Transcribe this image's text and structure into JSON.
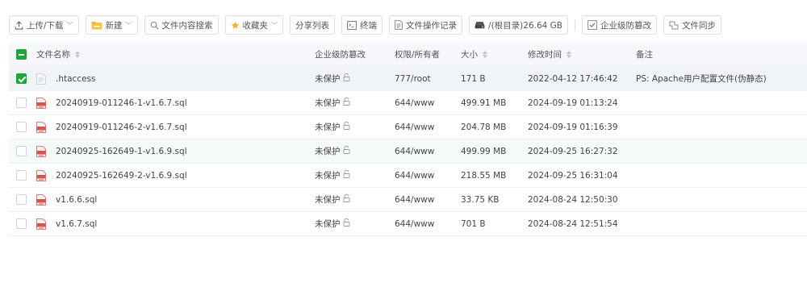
{
  "toolbar": {
    "upload_label": "上传/下载",
    "new_label": "新建",
    "search_label": "文件内容搜索",
    "favorites_label": "收藏夹",
    "share_label": "分享列表",
    "terminal_label": "终端",
    "oplog_label": "文件操作记录",
    "disk_label": "/(根目录)26.64 GB",
    "tamper_label": "企业级防篡改",
    "sync_label": "文件同步"
  },
  "table": {
    "headers": {
      "name": "文件名称",
      "protection": "企业级防篡改",
      "permission": "权限/所有者",
      "size": "大小",
      "modified": "修改时间",
      "note": "备注"
    },
    "rows": [
      {
        "name": ".htaccess",
        "protection": "未保护",
        "permission": "777/root",
        "size": "171 B",
        "modified": "2022-04-12 17:46:42",
        "note": "PS: Apache用户配置文件(伪静态)",
        "type": "text",
        "checked": true
      },
      {
        "name": "20240919-011246-1-v1.6.7.sql",
        "protection": "未保护",
        "permission": "644/www",
        "size": "499.91 MB",
        "modified": "2024-09-19 01:13:24",
        "note": "",
        "type": "sql",
        "checked": false
      },
      {
        "name": "20240919-011246-2-v1.6.7.sql",
        "protection": "未保护",
        "permission": "644/www",
        "size": "204.78 MB",
        "modified": "2024-09-19 01:16:39",
        "note": "",
        "type": "sql",
        "checked": false
      },
      {
        "name": "20240925-162649-1-v1.6.9.sql",
        "protection": "未保护",
        "permission": "644/www",
        "size": "499.99 MB",
        "modified": "2024-09-25 16:27:32",
        "note": "",
        "type": "sql",
        "checked": false
      },
      {
        "name": "20240925-162649-2-v1.6.9.sql",
        "protection": "未保护",
        "permission": "644/www",
        "size": "218.55 MB",
        "modified": "2024-09-25 16:31:04",
        "note": "",
        "type": "sql",
        "checked": false
      },
      {
        "name": "v1.6.6.sql",
        "protection": "未保护",
        "permission": "644/www",
        "size": "33.75 KB",
        "modified": "2024-08-24 12:50:30",
        "note": "",
        "type": "sql",
        "checked": false
      },
      {
        "name": "v1.6.7.sql",
        "protection": "未保护",
        "permission": "644/www",
        "size": "701 B",
        "modified": "2024-08-24 12:51:54",
        "note": "",
        "type": "sql",
        "checked": false
      }
    ]
  },
  "colors": {
    "accent": "#20a53a",
    "sql_icon": "#d9534f",
    "folder": "#f0b429"
  }
}
